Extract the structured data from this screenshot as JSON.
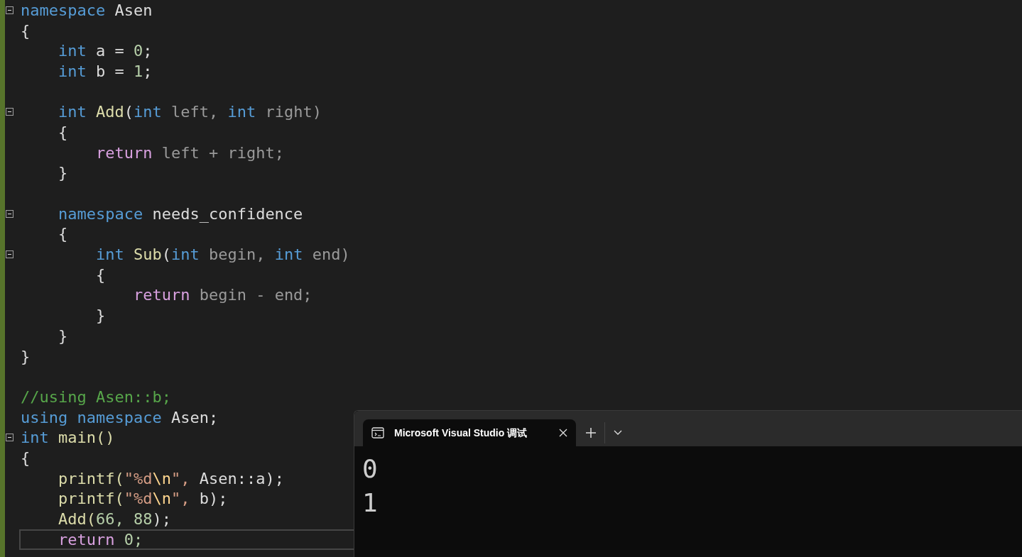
{
  "editor": {
    "lines": [
      {
        "fold": true,
        "current": false,
        "tokens": [
          {
            "t": "namespace ",
            "kind": "keyword"
          },
          {
            "t": "Asen",
            "kind": "plain"
          }
        ]
      },
      {
        "fold": false,
        "current": false,
        "tokens": [
          {
            "t": "{",
            "kind": "plain"
          }
        ]
      },
      {
        "fold": false,
        "current": false,
        "tokens": [
          {
            "t": "    int ",
            "kind": "keyword"
          },
          {
            "t": "a = ",
            "kind": "plain"
          },
          {
            "t": "0",
            "kind": "number"
          },
          {
            "t": ";",
            "kind": "plain"
          }
        ]
      },
      {
        "fold": false,
        "current": false,
        "tokens": [
          {
            "t": "    int ",
            "kind": "keyword"
          },
          {
            "t": "b = ",
            "kind": "plain"
          },
          {
            "t": "1",
            "kind": "number"
          },
          {
            "t": ";",
            "kind": "plain"
          }
        ]
      },
      {
        "fold": false,
        "current": false
      },
      {
        "fold": true,
        "current": false,
        "tokens": [
          {
            "t": "    int ",
            "kind": "keyword"
          },
          {
            "t": "Add",
            "kind": "function"
          },
          {
            "t": "(",
            "kind": "plain"
          },
          {
            "t": "int ",
            "kind": "keyword"
          },
          {
            "t": "left, ",
            "kind": "param"
          },
          {
            "t": "int ",
            "kind": "keyword"
          },
          {
            "t": "right)",
            "kind": "param"
          }
        ]
      },
      {
        "fold": false,
        "current": false,
        "tokens": [
          {
            "t": "    {",
            "kind": "plain"
          }
        ]
      },
      {
        "fold": false,
        "current": false,
        "tokens": [
          {
            "t": "        return ",
            "kind": "control"
          },
          {
            "t": "left + right;",
            "kind": "param"
          }
        ]
      },
      {
        "fold": false,
        "current": false,
        "tokens": [
          {
            "t": "    }",
            "kind": "plain"
          }
        ]
      },
      {
        "fold": false,
        "current": false
      },
      {
        "fold": true,
        "current": false,
        "tokens": [
          {
            "t": "    namespace ",
            "kind": "keyword"
          },
          {
            "t": "needs_confidence",
            "kind": "plain"
          }
        ]
      },
      {
        "fold": false,
        "current": false,
        "tokens": [
          {
            "t": "    {",
            "kind": "plain"
          }
        ]
      },
      {
        "fold": true,
        "current": false,
        "tokens": [
          {
            "t": "        int ",
            "kind": "keyword"
          },
          {
            "t": "Sub",
            "kind": "function"
          },
          {
            "t": "(",
            "kind": "plain"
          },
          {
            "t": "int ",
            "kind": "keyword"
          },
          {
            "t": "begin, ",
            "kind": "param"
          },
          {
            "t": "int ",
            "kind": "keyword"
          },
          {
            "t": "end)",
            "kind": "param"
          }
        ]
      },
      {
        "fold": false,
        "current": false,
        "tokens": [
          {
            "t": "        {",
            "kind": "plain"
          }
        ]
      },
      {
        "fold": false,
        "current": false,
        "tokens": [
          {
            "t": "            return ",
            "kind": "control"
          },
          {
            "t": "begin - end;",
            "kind": "param"
          }
        ]
      },
      {
        "fold": false,
        "current": false,
        "tokens": [
          {
            "t": "        }",
            "kind": "plain"
          }
        ]
      },
      {
        "fold": false,
        "current": false,
        "tokens": [
          {
            "t": "    }",
            "kind": "plain"
          }
        ]
      },
      {
        "fold": false,
        "current": false,
        "tokens": [
          {
            "t": "}",
            "kind": "plain"
          }
        ]
      },
      {
        "fold": false,
        "current": false
      },
      {
        "fold": false,
        "current": false,
        "tokens": [
          {
            "t": "//using Asen::b;",
            "kind": "comment"
          }
        ]
      },
      {
        "fold": false,
        "current": false,
        "tokens": [
          {
            "t": "using namespace ",
            "kind": "keyword"
          },
          {
            "t": "Asen;",
            "kind": "plain"
          }
        ]
      },
      {
        "fold": true,
        "current": false,
        "tokens": [
          {
            "t": "int ",
            "kind": "keyword"
          },
          {
            "t": "main()",
            "kind": "function"
          }
        ]
      },
      {
        "fold": false,
        "current": false,
        "tokens": [
          {
            "t": "{",
            "kind": "plain"
          }
        ]
      },
      {
        "fold": false,
        "current": false,
        "tokens": [
          {
            "t": "    printf(",
            "kind": "function"
          },
          {
            "t": "\"%d",
            "kind": "string"
          },
          {
            "t": "\\n",
            "kind": "escape"
          },
          {
            "t": "\", ",
            "kind": "string"
          },
          {
            "t": "Asen::a);",
            "kind": "plain"
          }
        ]
      },
      {
        "fold": false,
        "current": false,
        "tokens": [
          {
            "t": "    printf(",
            "kind": "function"
          },
          {
            "t": "\"%d",
            "kind": "string"
          },
          {
            "t": "\\n",
            "kind": "escape"
          },
          {
            "t": "\", ",
            "kind": "string"
          },
          {
            "t": "b);",
            "kind": "plain"
          }
        ]
      },
      {
        "fold": false,
        "current": false,
        "tokens": [
          {
            "t": "    Add(",
            "kind": "function"
          },
          {
            "t": "66, 88",
            "kind": "number"
          },
          {
            "t": ");",
            "kind": "plain"
          }
        ]
      },
      {
        "fold": false,
        "current": true,
        "tokens": [
          {
            "t": "    return ",
            "kind": "control"
          },
          {
            "t": "0;",
            "kind": "number"
          }
        ]
      }
    ]
  },
  "terminal": {
    "tabs": [
      {
        "title": "Microsoft Visual Studio 调试",
        "selected": true
      }
    ],
    "output": [
      "0",
      "1"
    ]
  }
}
